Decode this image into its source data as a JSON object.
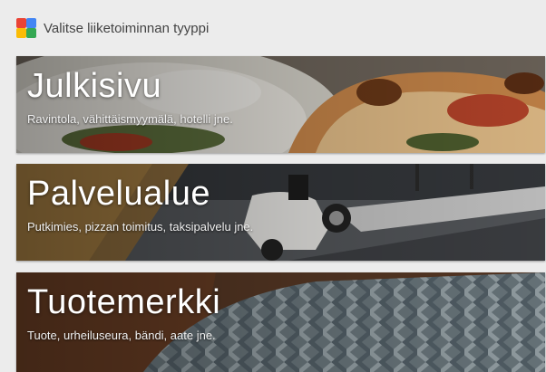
{
  "header": {
    "title": "Valitse liiketoiminnan tyyppi",
    "logo_colors": [
      "#ea4335",
      "#4285f4",
      "#fbbc05",
      "#34a853"
    ]
  },
  "cards": [
    {
      "title": "Julkisivu",
      "subtitle": "Ravintola, vähittäismyymälä, hotelli jne."
    },
    {
      "title": "Palvelualue",
      "subtitle": "Putkimies, pizzan toimitus, taksipalvelu jne."
    },
    {
      "title": "Tuotemerkki",
      "subtitle": "Tuote, urheiluseura, bändi, aate jne."
    }
  ]
}
